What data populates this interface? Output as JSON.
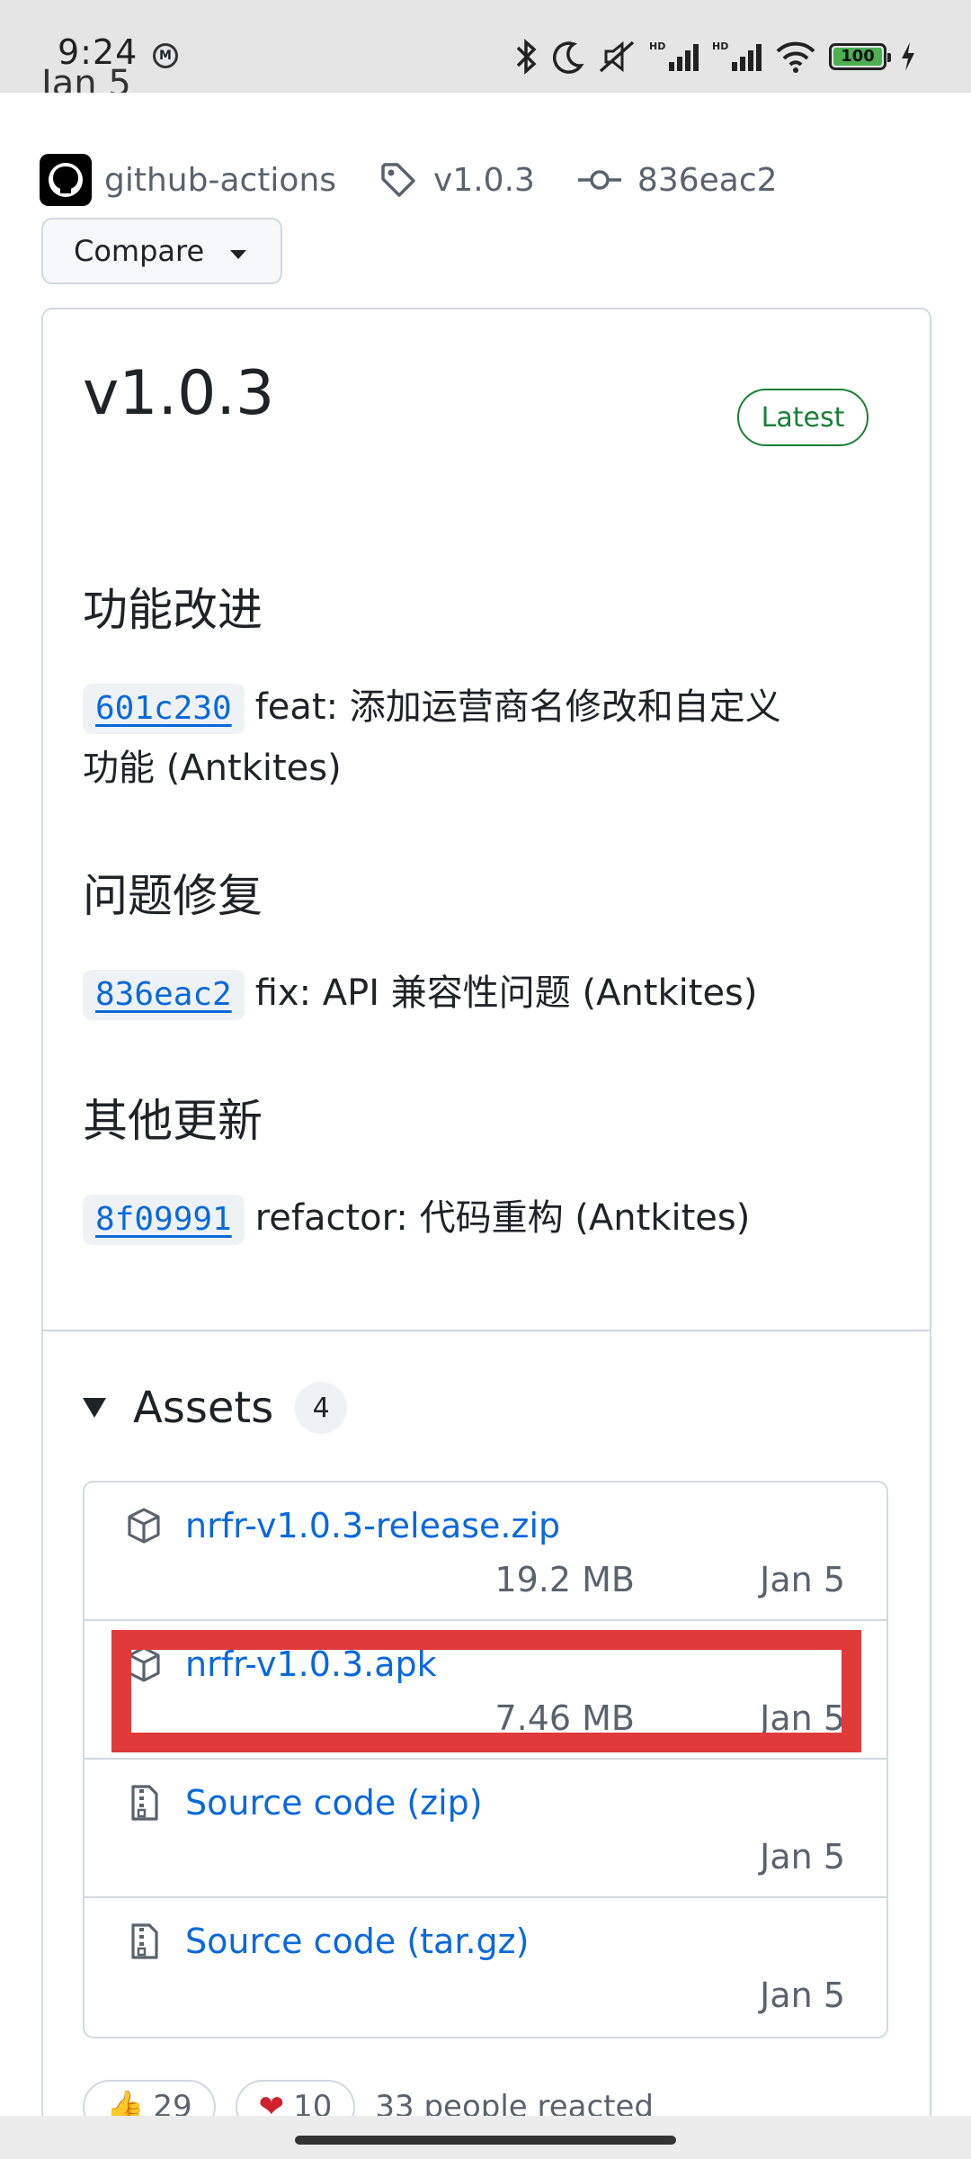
{
  "status_bar": {
    "time": "9:24",
    "battery": "100"
  },
  "header": {
    "date_partial": "Jan 5",
    "author": "github-actions",
    "tag": "v1.0.3",
    "commit": "836eac2",
    "compare_label": "Compare"
  },
  "release": {
    "title": "v1.0.3",
    "badge": "Latest",
    "sections": [
      {
        "heading": "功能改进",
        "sha": "601c230",
        "text_line1": "feat: 添加运营商名修改和自定义",
        "text_line2": "功能 (Antkites)"
      },
      {
        "heading": "问题修复",
        "sha": "836eac2",
        "text_line1": "fix: API 兼容性问题 (Antkites)"
      },
      {
        "heading": "其他更新",
        "sha": "8f09991",
        "text_line1": "refactor: 代码重构 (Antkites)"
      }
    ]
  },
  "assets": {
    "label": "Assets",
    "count": "4",
    "items": [
      {
        "name": "nrfr-v1.0.3-release.zip",
        "size": "19.2 MB",
        "date": "Jan 5",
        "icon": "package-icon"
      },
      {
        "name": "nrfr-v1.0.3.apk",
        "size": "7.46 MB",
        "date": "Jan 5",
        "icon": "package-icon"
      },
      {
        "name": "Source code (zip)",
        "size": "",
        "date": "Jan 5",
        "icon": "file-zip-icon"
      },
      {
        "name": "Source code (tar.gz)",
        "size": "",
        "date": "Jan 5",
        "icon": "file-zip-icon"
      }
    ]
  },
  "reactions": {
    "thumbs_count": "29",
    "heart_count": "10",
    "summary": "33 people reacted"
  },
  "colors": {
    "link": "#0969da",
    "latest_green": "#1a7f37",
    "highlight_red": "#e03a3a"
  }
}
